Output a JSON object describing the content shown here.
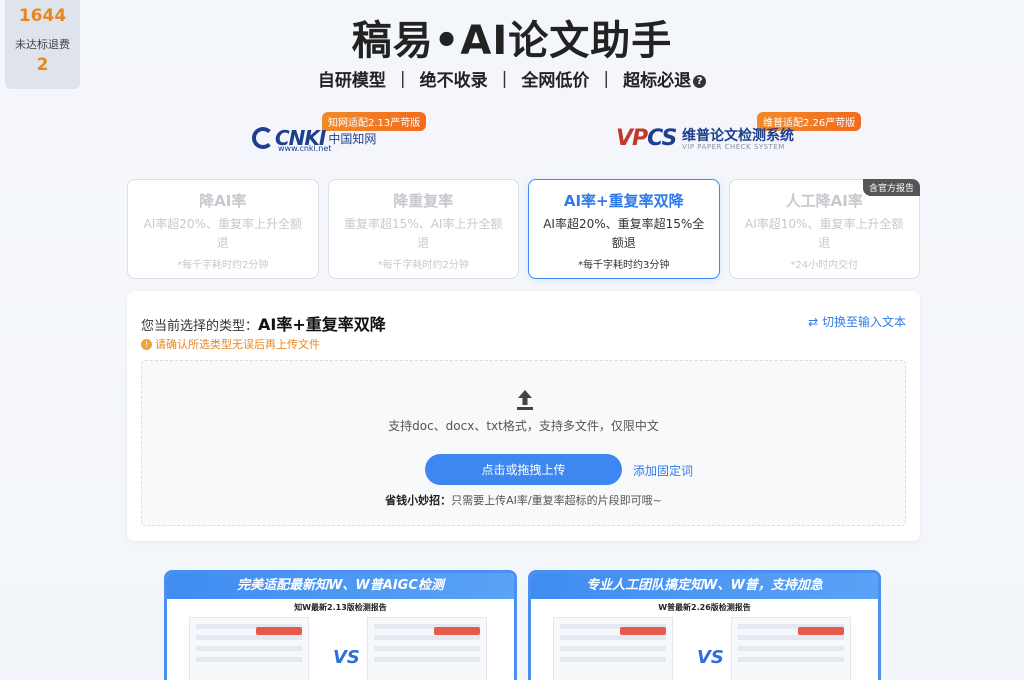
{
  "stats": {
    "value1": "1644",
    "label2": "未达标退费",
    "value2": "2"
  },
  "header": {
    "title": "稿易•AI论文助手",
    "features": [
      "自研模型",
      "绝不收录",
      "全网低价",
      "超标必退"
    ],
    "separator": "|",
    "help_icon": "question-circle-icon"
  },
  "logos": {
    "cnki": {
      "badge": "知网适配2.13严苛版",
      "mark": "CNKI",
      "name_zh": "中国知网",
      "url": "www.cnki.net"
    },
    "vpcs": {
      "badge": "维普适配2.26严苛版",
      "mark_red": "VP",
      "mark_blue": "CS",
      "name": "维普论文检测系统",
      "sub": "VIP PAPER CHECK SYSTEM"
    }
  },
  "modes": [
    {
      "title": "降AI率",
      "desc": "AI率超20%、重复率上升全额退",
      "time": "*每千字耗时约2分钟",
      "active": false
    },
    {
      "title": "降重复率",
      "desc": "重复率超15%、AI率上升全额退",
      "time": "*每千字耗时约2分钟",
      "active": false
    },
    {
      "title": "AI率+重复率双降",
      "desc": "AI率超20%、重复率超15%全额退",
      "time": "*每千字耗时约3分钟",
      "active": true
    },
    {
      "title": "人工降AI率",
      "desc": "AI率超10%、重复率上升全额退",
      "time": "*24小时内交付",
      "active": false,
      "corner": "含官方报告"
    }
  ],
  "panel": {
    "current_label": "您当前选择的类型：",
    "current_value": "AI率+重复率双降",
    "switch_label": "切换至输入文本",
    "warning": "请确认所选类型无误后再上传文件",
    "support_text": "支持doc、docx、txt格式，支持多文件，仅限中文",
    "upload_button": "点击或拖拽上传",
    "add_fixed": "添加固定词",
    "tip_bold": "省钱小妙招：",
    "tip_text": "只需要上传AI率/重复率超标的片段即可哦~"
  },
  "promos": [
    {
      "headline": "完美适配最新知W、W普AIGC检测",
      "subtitle": "知W最新2.13版检测报告",
      "vs": "VS"
    },
    {
      "headline": "专业人工团队搞定知W、W普，支持加急",
      "subtitle": "W普最新2.26版检测报告",
      "vs": "VS"
    }
  ]
}
